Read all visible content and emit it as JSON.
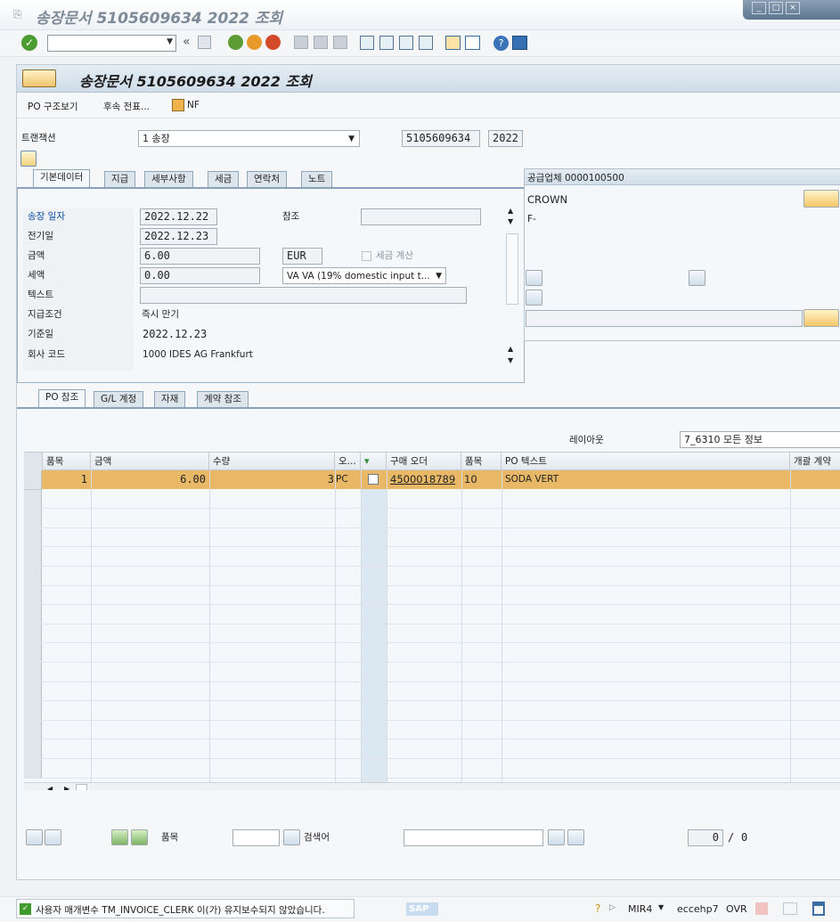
{
  "window": {
    "title": "송장문서 5105609634 2022 조회"
  },
  "toolbar": {
    "command_value": ""
  },
  "screen": {
    "title": "송장문서 5105609634 2022 조회"
  },
  "app_toolbar": {
    "po_structure": "PO 구조보기",
    "follow_on_docs": "후속 전표...",
    "nf": "NF"
  },
  "header": {
    "transaction_label": "트랜잭션",
    "transaction_value": "1 송장",
    "doc_number": "5105609634",
    "fiscal_year": "2022"
  },
  "tabs": [
    "기본데이터",
    "지급",
    "세부사항",
    "세금",
    "연락처",
    "노트"
  ],
  "basic": {
    "invoice_date_label": "송장 일자",
    "invoice_date": "2022.12.22",
    "reference_label": "참조",
    "reference": "",
    "posting_date_label": "전기일",
    "posting_date": "2022.12.23",
    "amount_label": "금액",
    "amount": "6.00",
    "currency": "EUR",
    "calc_tax_label": "세금 계산",
    "tax_amount_label": "세액",
    "tax_amount": "0.00",
    "tax_code": "VA VA (19% domestic input t...",
    "text_label": "텍스트",
    "text": "",
    "payment_terms_label": "지급조건",
    "payment_terms": "즉시 만기",
    "baseline_date_label": "기준일",
    "baseline_date": "2022.12.23",
    "company_code_label": "회사 코드",
    "company_code": "1000 IDES AG Frankfurt"
  },
  "vendor": {
    "title": "공급업체 0000100500",
    "name": "CROWN",
    "line2": "F-"
  },
  "lower_tabs": [
    "PO 참조",
    "G/L 계정",
    "자재",
    "계약 참조"
  ],
  "layout": {
    "label": "레이아웃",
    "value": "7_6310 모든 정보"
  },
  "table": {
    "columns": [
      "품목",
      "금액",
      "수량",
      "오...",
      "",
      "구매 오더",
      "품목",
      "PO 텍스트",
      "개괄 계약"
    ],
    "rows": [
      {
        "item": "1",
        "amount": "6.00",
        "qty": "3",
        "unit": "PC",
        "po": "4500018789",
        "po_item": "10",
        "po_text": "SODA VERT"
      }
    ]
  },
  "search": {
    "item_label": "품목",
    "search_label": "검색어",
    "count": "0",
    "sep": "/",
    "total": "0"
  },
  "status": {
    "message": "사용자 매개변수 TM_INVOICE_CLERK 이(가) 유지보수되지 않았습니다.",
    "tcode": "MIR4",
    "server": "eccehp7",
    "mode": "OVR",
    "sap_logo": "SAP"
  },
  "colors": {
    "selected_row": "#e8b867",
    "title_bar": "#d4e1ec",
    "accent_link": "#0c4ea0"
  }
}
